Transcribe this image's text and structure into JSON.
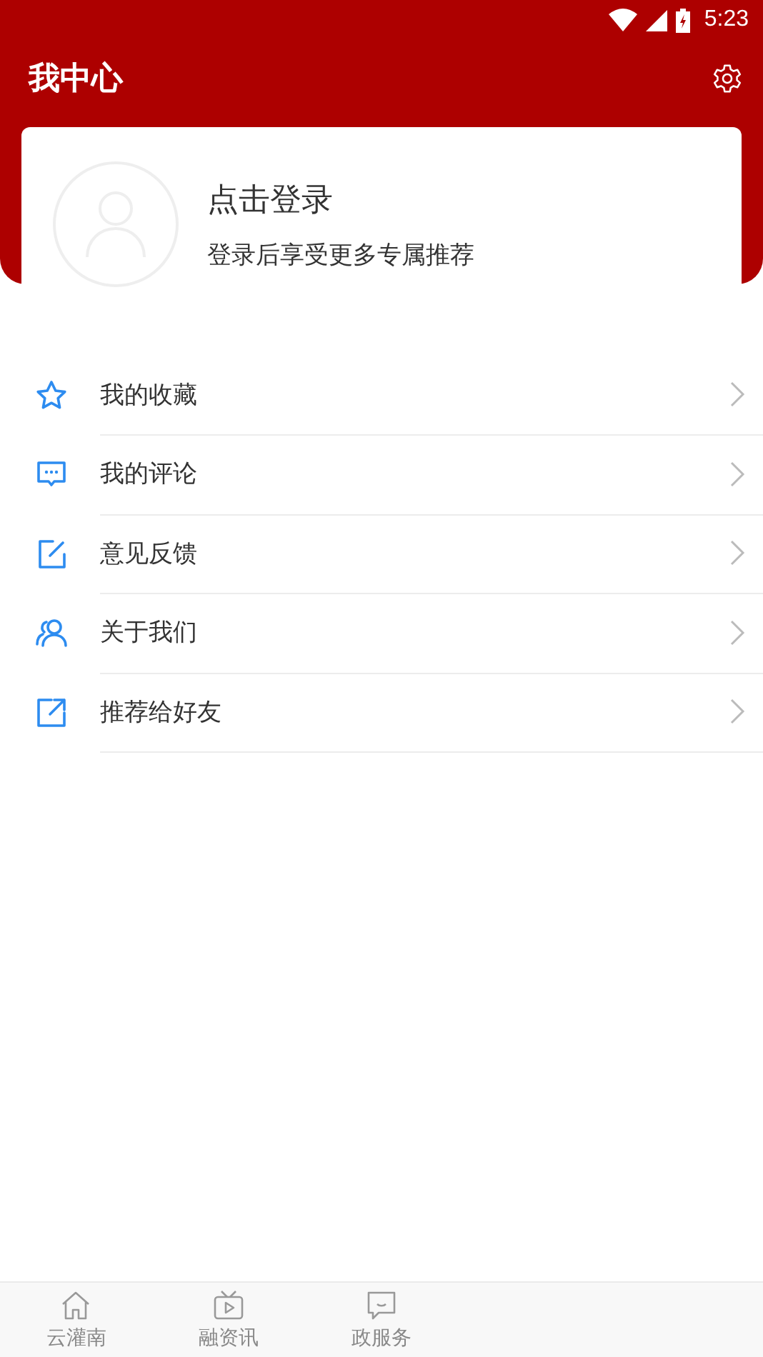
{
  "status_bar": {
    "time": "5:23"
  },
  "header": {
    "title": "我中心"
  },
  "login_card": {
    "title": "点击登录",
    "subtitle": "登录后享受更多专属推荐"
  },
  "menu": [
    {
      "kind": "star",
      "label": "我的收藏"
    },
    {
      "kind": "comment",
      "label": "我的评论"
    },
    {
      "kind": "edit",
      "label": "意见反馈"
    },
    {
      "kind": "people",
      "label": "关于我们"
    },
    {
      "kind": "share",
      "label": "推荐给好友"
    }
  ],
  "tab_bar": [
    {
      "kind": "home",
      "label": "云灌南",
      "selected": false
    },
    {
      "kind": "tv",
      "label": "融资讯",
      "selected": false
    },
    {
      "kind": "chat",
      "label": "政服务",
      "selected": false
    }
  ]
}
